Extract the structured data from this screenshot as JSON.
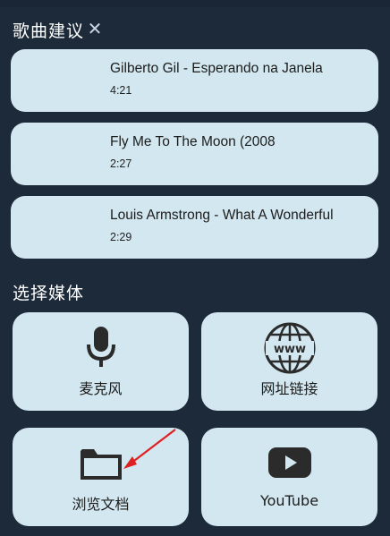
{
  "suggestions": {
    "title": "歌曲建议",
    "close_icon": "close-icon",
    "songs": [
      {
        "title": "Gilberto Gil - Esperando na Janela",
        "duration": "4:21"
      },
      {
        "title": "Fly Me To The Moon (2008",
        "duration": "2:27"
      },
      {
        "title": "Louis Armstrong - What A Wonderful",
        "duration": "2:29"
      }
    ]
  },
  "media": {
    "title": "选择媒体",
    "options": [
      {
        "label": "麦克风",
        "icon": "microphone-icon"
      },
      {
        "label": "网址链接",
        "icon": "globe-www-icon"
      },
      {
        "label": "浏览文档",
        "icon": "folder-icon"
      },
      {
        "label": "YouTube",
        "icon": "youtube-icon"
      }
    ]
  },
  "colors": {
    "background": "#1d2a3a",
    "card": "#d2e7ef",
    "annotation_arrow": "#e02020"
  }
}
